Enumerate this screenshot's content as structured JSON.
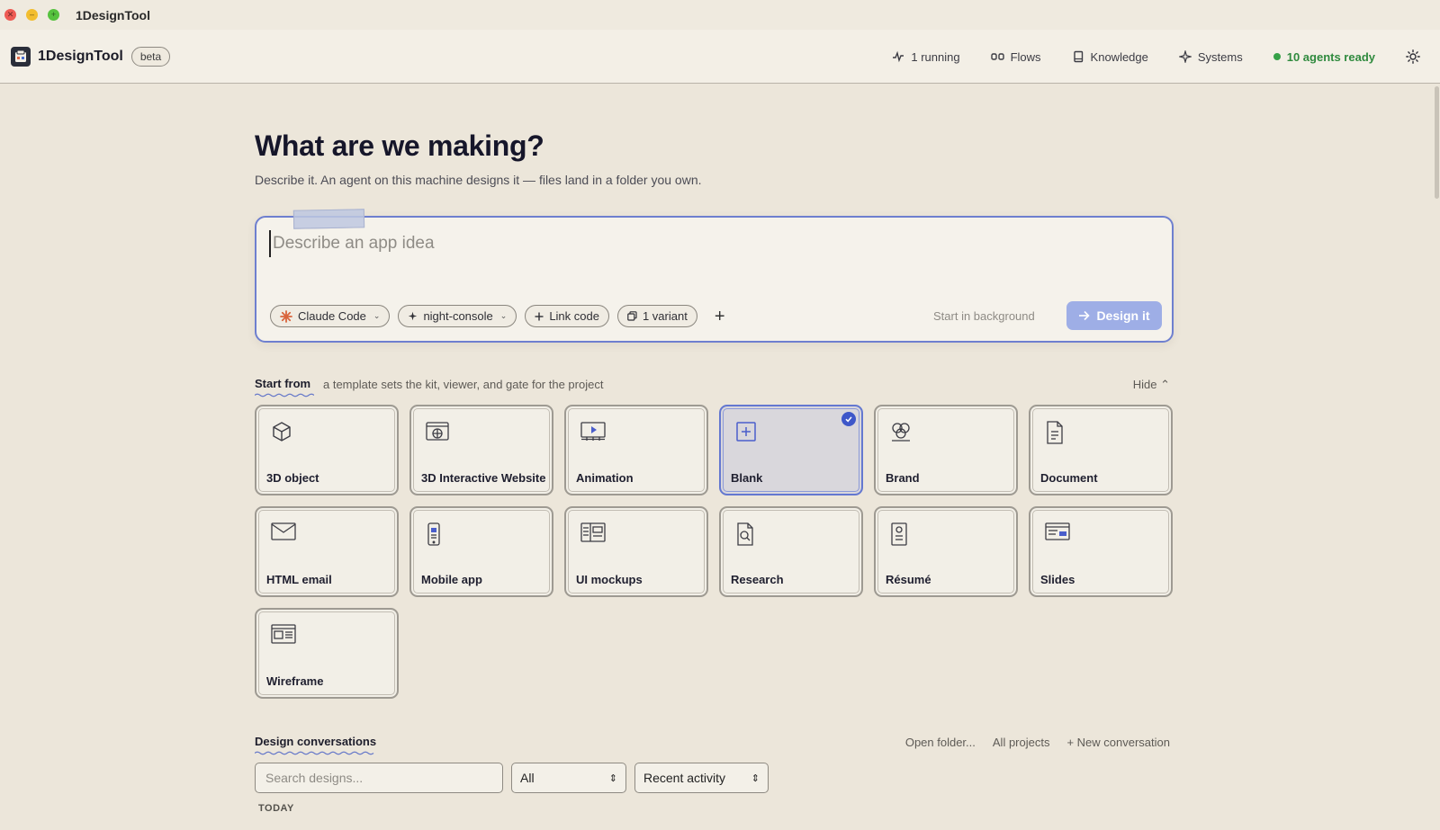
{
  "window": {
    "title": "1DesignTool"
  },
  "header": {
    "brand": "1DesignTool",
    "badge": "beta",
    "nav": {
      "running": "1 running",
      "flows": "Flows",
      "knowledge": "Knowledge",
      "systems": "Systems",
      "agents": "10 agents ready"
    }
  },
  "hero": {
    "title": "What are we making?",
    "subtitle": "Describe it. An agent on this machine designs it — files land in a folder you own."
  },
  "prompt": {
    "placeholder": "Describe an app idea",
    "chips": {
      "engine": "Claude Code",
      "theme": "night-console",
      "link": "Link code",
      "variants": "1 variant"
    },
    "background_label": "Start in background",
    "submit_label": "Design it"
  },
  "templates": {
    "title": "Start from",
    "subtitle": "a template sets the kit, viewer, and gate for the project",
    "hide_label": "Hide",
    "items": [
      {
        "label": "3D object",
        "icon": "cube-icon"
      },
      {
        "label": "3D Interactive Website",
        "icon": "globe-window-icon"
      },
      {
        "label": "Animation",
        "icon": "play-frame-icon"
      },
      {
        "label": "Blank",
        "icon": "plus-square-icon",
        "selected": true
      },
      {
        "label": "Brand",
        "icon": "brand-circles-icon"
      },
      {
        "label": "Document",
        "icon": "document-icon"
      },
      {
        "label": "HTML email",
        "icon": "envelope-icon"
      },
      {
        "label": "Mobile app",
        "icon": "phone-icon"
      },
      {
        "label": "UI mockups",
        "icon": "layout-icon"
      },
      {
        "label": "Research",
        "icon": "search-doc-icon"
      },
      {
        "label": "Résumé",
        "icon": "resume-icon"
      },
      {
        "label": "Slides",
        "icon": "slides-icon"
      },
      {
        "label": "Wireframe",
        "icon": "wireframe-icon"
      }
    ]
  },
  "conversations": {
    "title": "Design conversations",
    "open_folder": "Open folder...",
    "all_projects": "All projects",
    "new_conversation": "+ New conversation",
    "search_placeholder": "Search designs...",
    "filter_value": "All",
    "sort_value": "Recent activity",
    "group_label": "TODAY"
  },
  "colors": {
    "accent": "#3e57c9",
    "submit_bg": "#9eaee6",
    "agents_status": "#2f8a3e",
    "page_bg": "#ece6da"
  }
}
